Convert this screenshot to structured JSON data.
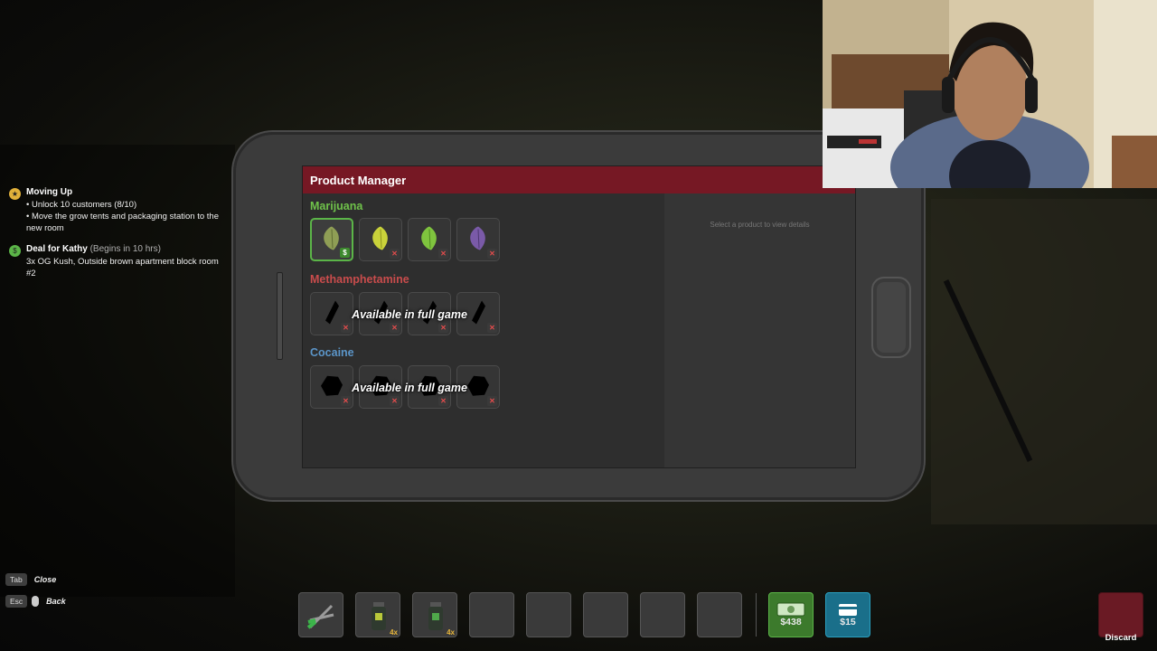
{
  "quests": [
    {
      "title": "Moving Up",
      "subtitle": "",
      "icon": "star-icon",
      "lines": [
        "• Unlock 10 customers (8/10)",
        "• Move the grow tents and packaging station to the new room"
      ]
    },
    {
      "title": "Deal for Kathy",
      "subtitle": "(Begins in 10 hrs)",
      "icon": "deal-icon",
      "lines": [
        "3x OG Kush, Outside brown apartment block room #2"
      ]
    }
  ],
  "app": {
    "title": "Product Manager",
    "details_hint": "Select a product to view details",
    "categories": [
      {
        "name": "Marijuana",
        "color": "#6fc24a"
      },
      {
        "name": "Methamphetamine",
        "color": "#c94c4c"
      },
      {
        "name": "Cocaine",
        "color": "#5b95c8"
      }
    ],
    "locked_text": "Available in full game",
    "slot_marks": {
      "listed": "$",
      "unlisted": "✕"
    }
  },
  "controls": [
    {
      "key": "Tab",
      "action": "Close"
    },
    {
      "key": "Esc",
      "action": "Back"
    }
  ],
  "hotbar": {
    "slots": [
      {
        "icon": "trimmers-icon",
        "qty": ""
      },
      {
        "icon": "soil-bottle-icon",
        "qty": "4x"
      },
      {
        "icon": "soil-bottle-icon",
        "qty": "4x"
      },
      {
        "icon": "",
        "qty": ""
      },
      {
        "icon": "",
        "qty": ""
      },
      {
        "icon": "",
        "qty": ""
      },
      {
        "icon": "",
        "qty": ""
      },
      {
        "icon": "",
        "qty": ""
      }
    ],
    "cash": "$438",
    "bank": "$15",
    "discard_label": "Discard"
  },
  "colors": {
    "titlebar": "#761824",
    "accent_green": "#5bb548",
    "cash_bg": "#3c7a2c",
    "bank_bg": "#1a6f8a"
  }
}
